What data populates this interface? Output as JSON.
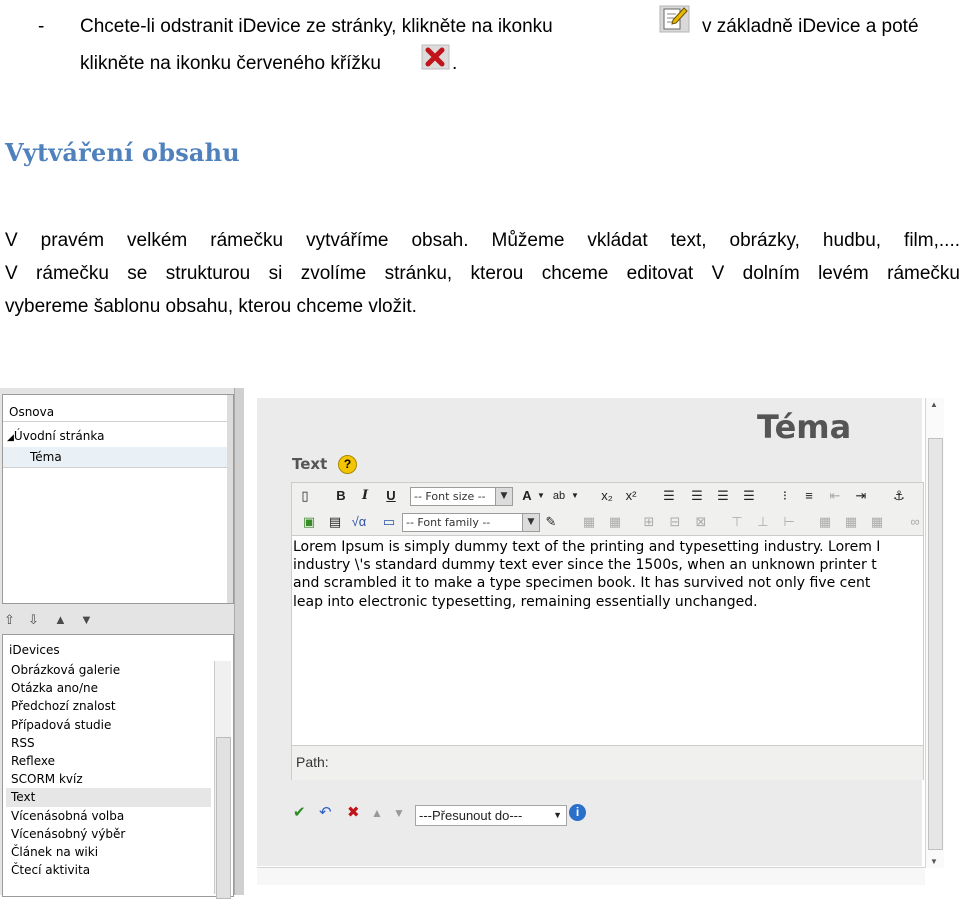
{
  "doc": {
    "bullet_dash": "-",
    "bullet_part1": "Chcete-li  odstranit  iDevice  ze  stránky,  klikněte  na  ikonku",
    "bullet_part2": "v  základně  iDevice  a  poté",
    "bullet_line2": "klikněte na ikonku červeného křížku",
    "bullet_end": ".",
    "heading": "Vytváření obsahu",
    "para_line1": "V pravém velkém rámečku vytváříme obsah. Můžeme vkládat text, obrázky, hudbu, film,....",
    "para_line2": "V rámečku se strukturou si zvolíme stránku, kterou chceme editovat V dolním levém rámečku",
    "para_line3": "vybereme šablonu obsahu, kterou chceme vložit."
  },
  "left_pane": {
    "outline_title": "Osnova",
    "tree_root": "Úvodní stránka",
    "tree_child": "Téma",
    "idevices_title": "iDevices",
    "idevices": [
      "Obrázková galerie",
      "Otázka ano/ne",
      "Předchozí znalost",
      "Případová studie",
      "RSS",
      "Reflexe",
      "SCORM kvíz",
      "Text",
      "Vícenásobná volba",
      "Vícenásobný výběr",
      "Článek na wiki",
      "Čtecí aktivita"
    ]
  },
  "right_pane": {
    "page_title": "Téma",
    "idevice_label": "Text",
    "font_size_select": "-- Font size --",
    "font_family_select": "-- Font family --",
    "editor_lines": [
      "Lorem Ipsum is simply dummy text of the printing and typesetting industry. Lorem I",
      "industry \\'s standard dummy text ever since the 1500s, when an unknown printer t",
      "and scrambled it to make a type specimen book. It has survived not only five cent",
      "leap into electronic typesetting, remaining essentially unchanged."
    ],
    "path_label": "Path:",
    "move_select": "---Přesunout do---"
  }
}
